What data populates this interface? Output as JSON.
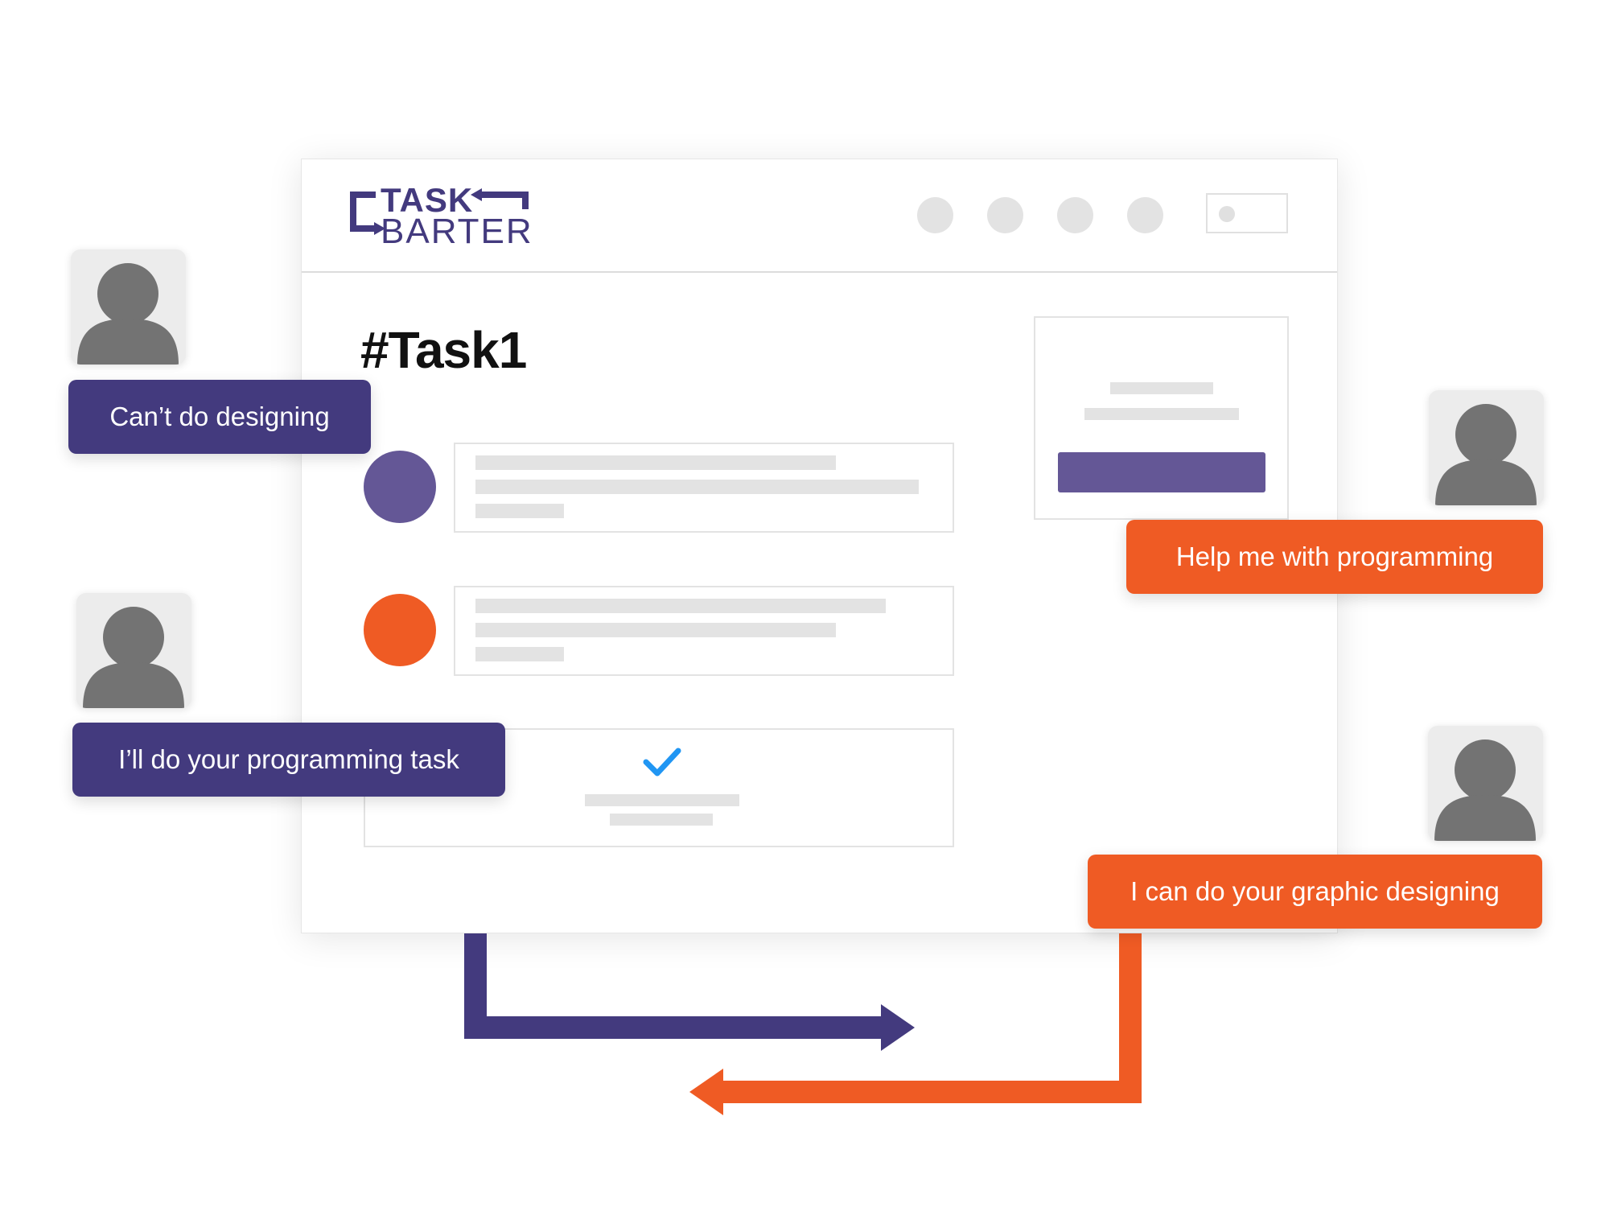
{
  "brand": {
    "line1": "TASK",
    "line2": "BARTER"
  },
  "page": {
    "title": "#Task1"
  },
  "messages": {
    "cant_do_designing": "Can’t do designing",
    "programming_task": "I’ll do your programming task",
    "help_programming": "Help me with programming",
    "graphic_designing": "I can do your graphic designing"
  },
  "icons": {
    "user": "user-avatar-icon",
    "check": "checkmark-icon",
    "arrow_right": "arrow-right-icon",
    "arrow_left": "arrow-left-icon"
  },
  "colors": {
    "purple": "#433a7e",
    "purple_light": "#645796",
    "orange": "#ef5b24",
    "placeholder": "#e3e3e3",
    "check_blue": "#2196f3"
  }
}
